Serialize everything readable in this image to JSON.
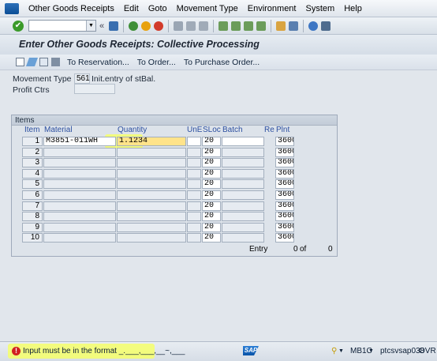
{
  "menu": [
    "Other Goods Receipts",
    "Edit",
    "Goto",
    "Movement Type",
    "Environment",
    "System",
    "Help"
  ],
  "toolbar": {
    "back_symbol": "«"
  },
  "title": "Enter Other Goods Receipts: Collective Processing",
  "app_buttons": [
    "To Reservation...",
    "To Order...",
    "To Purchase Order..."
  ],
  "header": {
    "movement_type_label": "Movement Type",
    "movement_type_value": "561",
    "movement_type_text": "Init.entry of stBal.",
    "profit_ctr_label": "Profit Ctrs",
    "profit_ctr_value": ""
  },
  "items": {
    "box_title": "Items",
    "columns": [
      "Item",
      "Material",
      "Quantity",
      "UnE",
      "SLoc",
      "Batch",
      "Re",
      "Plnt"
    ],
    "rows": [
      {
        "item": "1",
        "material": "M3851-011WH",
        "quantity": "1.1234",
        "une": "",
        "sloc": "20",
        "batch": "",
        "plnt": "3600"
      },
      {
        "item": "2",
        "material": "",
        "quantity": "",
        "une": "",
        "sloc": "20",
        "batch": "",
        "plnt": "3600"
      },
      {
        "item": "3",
        "material": "",
        "quantity": "",
        "une": "",
        "sloc": "20",
        "batch": "",
        "plnt": "3600"
      },
      {
        "item": "4",
        "material": "",
        "quantity": "",
        "une": "",
        "sloc": "20",
        "batch": "",
        "plnt": "3600"
      },
      {
        "item": "5",
        "material": "",
        "quantity": "",
        "une": "",
        "sloc": "20",
        "batch": "",
        "plnt": "3600"
      },
      {
        "item": "6",
        "material": "",
        "quantity": "",
        "une": "",
        "sloc": "20",
        "batch": "",
        "plnt": "3600"
      },
      {
        "item": "7",
        "material": "",
        "quantity": "",
        "une": "",
        "sloc": "20",
        "batch": "",
        "plnt": "3600"
      },
      {
        "item": "8",
        "material": "",
        "quantity": "",
        "une": "",
        "sloc": "20",
        "batch": "",
        "plnt": "3600"
      },
      {
        "item": "9",
        "material": "",
        "quantity": "",
        "une": "",
        "sloc": "20",
        "batch": "",
        "plnt": "3600"
      },
      {
        "item": "10",
        "material": "",
        "quantity": "",
        "une": "",
        "sloc": "20",
        "batch": "",
        "plnt": "3600"
      }
    ],
    "entry_label": "Entry",
    "entry_value": "0",
    "of_label": "of",
    "total_value": "0"
  },
  "status": {
    "message": "Input must be in the format _.___,___,__~,___",
    "logo": "SAP",
    "client": "MB1C",
    "server": "ptcsvsap038",
    "mode": "OVR"
  },
  "colors": {
    "error": "#d12121",
    "highlight": "#f6ff6a",
    "ok": "#3a9a2a"
  }
}
